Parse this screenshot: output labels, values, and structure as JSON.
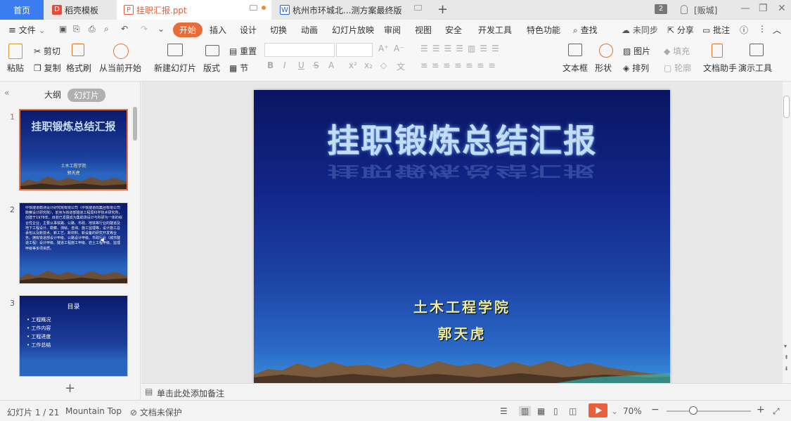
{
  "tabs": {
    "home": "首页",
    "tab2": "稻壳模板",
    "tab3": "挂职汇报.ppt",
    "tab4": "杭州市环城北...测方案最终版",
    "add": "+",
    "badge": "2",
    "user": "[贩城]"
  },
  "menu": {
    "file": "文件",
    "start": "开始",
    "insert": "插入",
    "design": "设计",
    "transition": "切换",
    "animation": "动画",
    "slideshow": "幻灯片放映",
    "review": "审阅",
    "view": "视图",
    "security": "安全",
    "devtools": "开发工具",
    "features": "特色功能",
    "search": "查找",
    "sync": "未同步",
    "share": "分享",
    "comment": "批注"
  },
  "ribbon": {
    "paste": "粘贴",
    "cut": "剪切",
    "copy": "复制",
    "format_painter": "格式刷",
    "from_current": "从当前开始",
    "new_slide": "新建幻灯片",
    "layout": "版式",
    "section": "节",
    "reset": "重置",
    "textbox": "文本框",
    "shape": "形状",
    "picture": "图片",
    "arrange": "排列",
    "fill": "填充",
    "outline": "轮廓",
    "doc_assistant": "文档助手",
    "present_tools": "演示工具"
  },
  "leftpanel": {
    "outline_tab": "大纲",
    "slides_tab": "幻灯片",
    "thumb_nums": [
      "1",
      "2",
      "3"
    ],
    "thumb1": {
      "title": "挂职锻炼总结汇报",
      "line1": "土木工程学院",
      "line2": "郭天虎"
    },
    "thumb2": {
      "text": "中铁隧道勘测设计研究院有限公司（中铁隧道局集团有限公司勘察设计研究院），前身为铁道部隧道工程局科学技术研究所，创建于1978年。目前已发展成为集勘测设计与科研为一体的综合性企业，主要从事铁路、公路、市政、地铁等行业的隧道及地下工程设计、勘察、测绘、咨询、施工监理等，设计施工总承包以及新技术、新工艺、新材料、新设备的研究开发等业务。拥有铁道部设计甲级、公路设计甲级、市政行业（城市隧道工程）设计甲级、隧道工程施工甲级、岩土工程甲级、监理甲级等多项资质。"
    },
    "thumb3": {
      "title": "目录",
      "items": [
        "工程概况",
        "工作内容",
        "工程进度",
        "工作总结"
      ]
    },
    "add": "+"
  },
  "slide": {
    "title": "挂职锻炼总结汇报",
    "school": "土木工程学院",
    "name": "郭天虎"
  },
  "notes": {
    "placeholder": "单击此处添加备注"
  },
  "status": {
    "slide_counter": "幻灯片 1 / 21",
    "theme": "Mountain Top",
    "protection": "文档未保护",
    "zoom": "70%"
  },
  "colors": {
    "accent": "#e66d3a",
    "home_tab": "#3a7df0",
    "slide_bg_top": "#0a1560",
    "slide_bg_bottom": "#3b8fd8",
    "subtitle": "#ecec9e"
  }
}
